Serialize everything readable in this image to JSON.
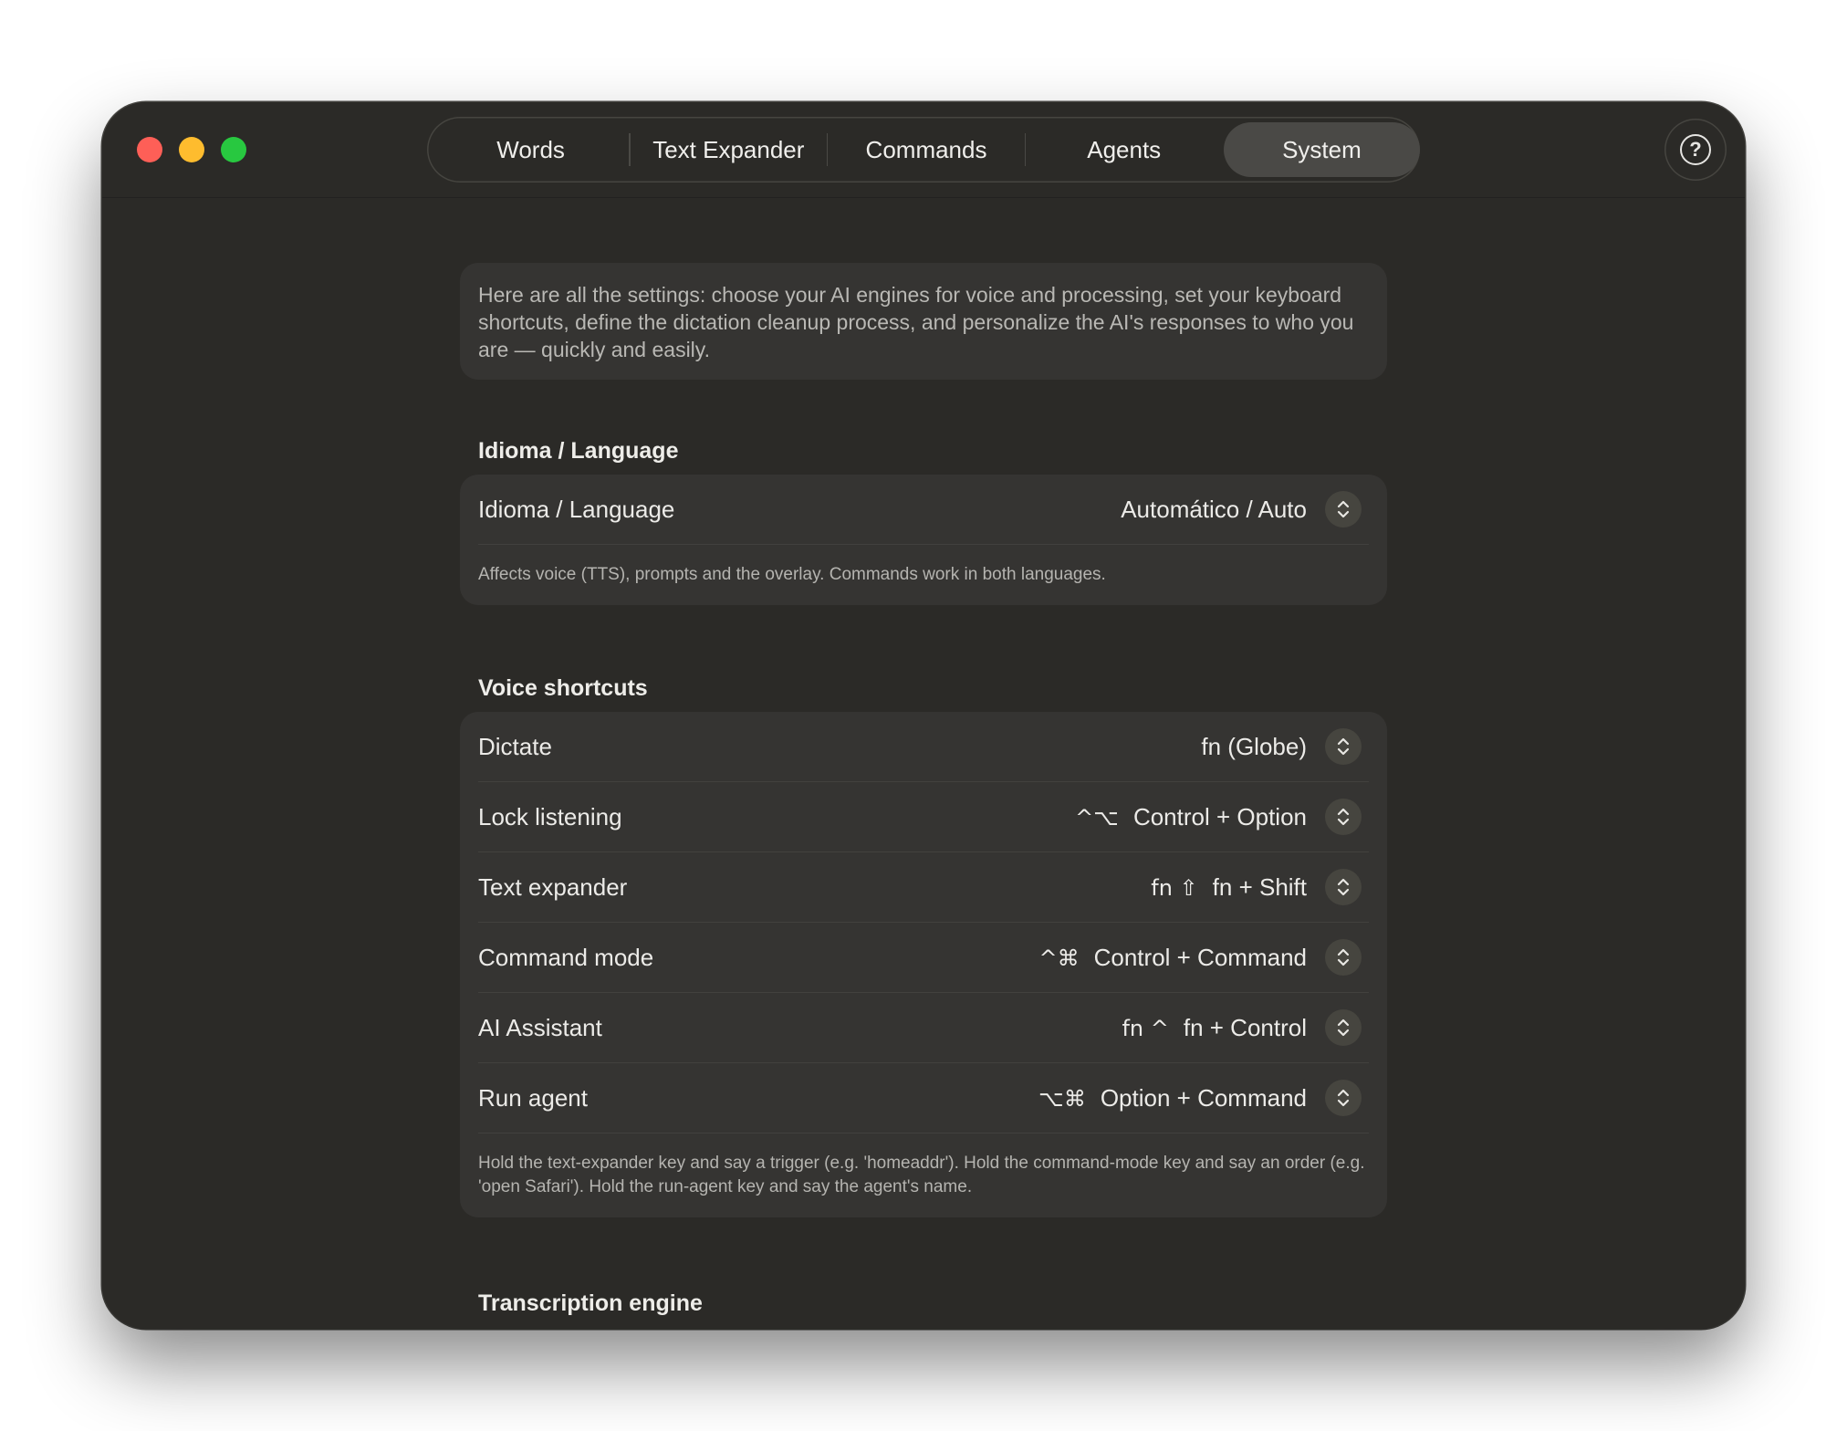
{
  "window": {
    "controls": [
      "close",
      "minimize",
      "zoom"
    ]
  },
  "tabs": [
    {
      "label": "Words",
      "active": false
    },
    {
      "label": "Text Expander",
      "active": false
    },
    {
      "label": "Commands",
      "active": false
    },
    {
      "label": "Agents",
      "active": false
    },
    {
      "label": "System",
      "active": true
    }
  ],
  "help": {
    "icon": "help-icon",
    "symbol": "?"
  },
  "intro": {
    "text": "Here are all the settings: choose your AI engines for voice and processing, set your keyboard shortcuts, define the dictation cleanup process, and personalize the AI's responses to who you are — quickly and easily."
  },
  "language": {
    "section_title": "Idioma / Language",
    "row_label": "Idioma / Language",
    "value": "Automático / Auto",
    "note": "Affects voice (TTS), prompts and the overlay. Commands work in both languages."
  },
  "voice_shortcuts": {
    "section_title": "Voice shortcuts",
    "rows": [
      {
        "label": "Dictate",
        "symbols": "",
        "value": "fn (Globe)"
      },
      {
        "label": "Lock listening",
        "symbols": "^⌥",
        "value": "Control + Option"
      },
      {
        "label": "Text expander",
        "symbols": "fn ⇧",
        "value": "fn + Shift"
      },
      {
        "label": "Command mode",
        "symbols": "^⌘",
        "value": "Control + Command"
      },
      {
        "label": "AI Assistant",
        "symbols": "fn ^",
        "value": "fn + Control"
      },
      {
        "label": "Run agent",
        "symbols": "⌥⌘",
        "value": "Option + Command"
      }
    ],
    "note": "Hold the text-expander key and say a trigger (e.g. 'homeaddr'). Hold the command-mode key and say an order (e.g. 'open Safari'). Hold the run-agent key and say the agent's name."
  },
  "transcription": {
    "section_title": "Transcription engine"
  },
  "colors": {
    "window_bg": "#2b2a27",
    "card_bg": "#353432",
    "active_tab": "#4a4946",
    "close": "#fe5f57",
    "minimize": "#febc2e",
    "zoom": "#28c840"
  }
}
